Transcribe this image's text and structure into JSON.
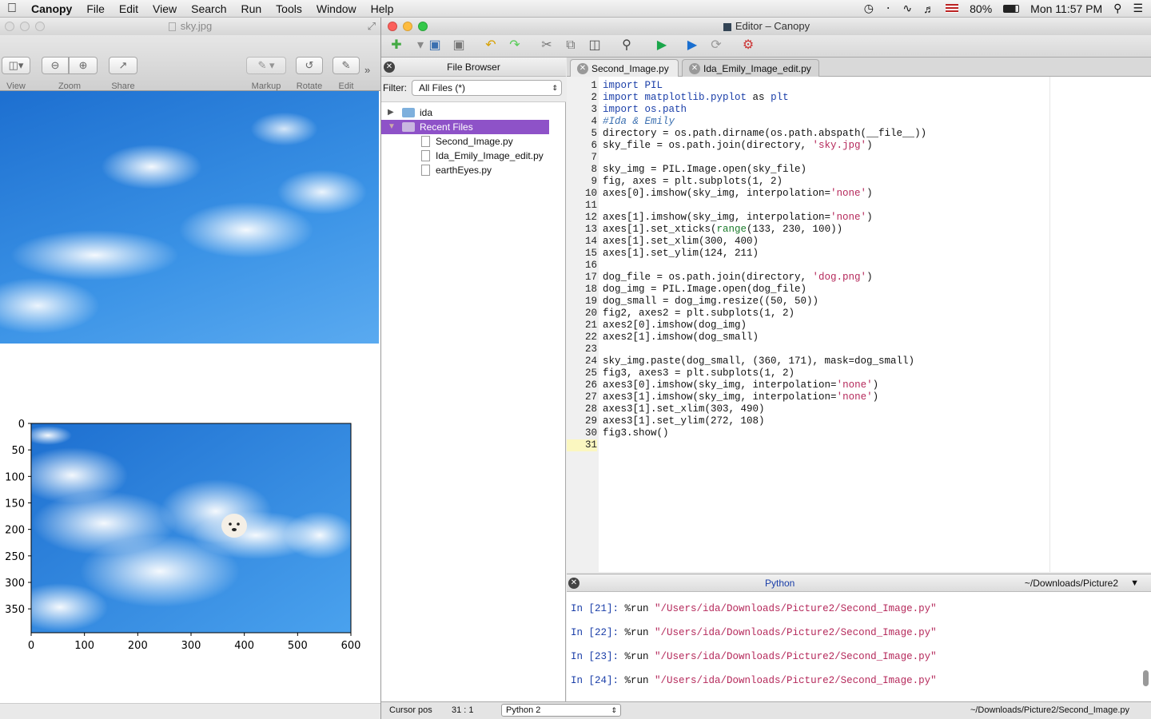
{
  "menubar": {
    "app": "Canopy",
    "items": [
      "File",
      "Edit",
      "View",
      "Search",
      "Run",
      "Tools",
      "Window",
      "Help"
    ],
    "battery": "80%",
    "clock": "Mon 11:57 PM"
  },
  "preview": {
    "title": "sky.jpg",
    "toolbar": {
      "view": "View",
      "zoom": "Zoom",
      "share": "Share",
      "markup": "Markup",
      "rotate": "Rotate",
      "edit": "Edit"
    },
    "xticks": [
      "0",
      "100",
      "200",
      "300",
      "400",
      "500",
      "600"
    ],
    "yticks": [
      "0",
      "50",
      "100",
      "150",
      "200",
      "250",
      "300",
      "350"
    ]
  },
  "chart_data": {
    "type": "image",
    "xticks": [
      0,
      100,
      200,
      300,
      400,
      500,
      600
    ],
    "yticks": [
      0,
      50,
      100,
      150,
      200,
      250,
      300,
      350
    ],
    "xlim": [
      0,
      600
    ],
    "ylim": [
      395,
      0
    ]
  },
  "editor": {
    "title": "Editor – Canopy",
    "file_browser": {
      "title": "File Browser",
      "filter_label": "Filter:",
      "filter_value": "All Files (*)",
      "folder": "ida",
      "recent": "Recent Files",
      "files": [
        "Second_Image.py",
        "Ida_Emily_Image_edit.py",
        "earthEyes.py"
      ]
    },
    "tabs": [
      "Second_Image.py",
      "Ida_Emily_Image_edit.py"
    ],
    "code_lines": [
      "import PIL",
      "import matplotlib.pyplot as plt",
      "import os.path",
      "#Ida & Emily",
      "directory = os.path.dirname(os.path.abspath(__file__))",
      "sky_file = os.path.join(directory, 'sky.jpg')",
      "",
      "sky_img = PIL.Image.open(sky_file)",
      "fig, axes = plt.subplots(1, 2)",
      "axes[0].imshow(sky_img, interpolation='none')",
      "",
      "axes[1].imshow(sky_img, interpolation='none')",
      "axes[1].set_xticks(range(133, 230, 100))",
      "axes[1].set_xlim(300, 400)",
      "axes[1].set_ylim(124, 211)",
      "",
      "dog_file = os.path.join(directory, 'dog.png')",
      "dog_img = PIL.Image.open(dog_file)",
      "dog_small = dog_img.resize((50, 50))",
      "fig2, axes2 = plt.subplots(1, 2)",
      "axes2[0].imshow(dog_img)",
      "axes2[1].imshow(dog_small)",
      "",
      "sky_img.paste(dog_small, (360, 171), mask=dog_small)",
      "fig3, axes3 = plt.subplots(1, 2)",
      "axes3[0].imshow(sky_img, interpolation='none')",
      "axes3[1].imshow(sky_img, interpolation='none')",
      "axes3[1].set_xlim(303, 490)",
      "axes3[1].set_ylim(272, 108)",
      "fig3.show()",
      ""
    ],
    "python": {
      "title": "Python",
      "cwd": "~/Downloads/Picture2",
      "lines": [
        {
          "prompt": "In [21]:",
          "cmd": "%run",
          "arg": "\"/Users/ida/Downloads/Picture2/Second_Image.py\""
        },
        {
          "prompt": "In [22]:",
          "cmd": "%run",
          "arg": "\"/Users/ida/Downloads/Picture2/Second_Image.py\""
        },
        {
          "prompt": "In [23]:",
          "cmd": "%run",
          "arg": "\"/Users/ida/Downloads/Picture2/Second_Image.py\""
        },
        {
          "prompt": "In [24]:",
          "cmd": "%run",
          "arg": "\"/Users/ida/Downloads/Picture2/Second_Image.py\""
        }
      ]
    },
    "status": {
      "cursor_label": "Cursor pos",
      "cursor_pos": "31 : 1",
      "interpreter": "Python 2",
      "path": "~/Downloads/Picture2/Second_Image.py"
    }
  },
  "colors": {
    "selection": "#8e52c8",
    "prompt": "#1a3ea8",
    "string": "#b5295b",
    "keyword": "#1a3ea8",
    "comment": "#3a6fb0",
    "current_line": "#fbf7c0"
  }
}
